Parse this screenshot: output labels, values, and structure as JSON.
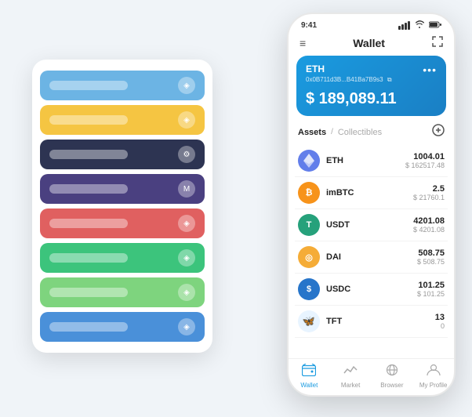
{
  "scene": {
    "card_stack": {
      "cards": [
        {
          "color": "#6cb4e4",
          "label": "",
          "icon": "◈"
        },
        {
          "color": "#f5c542",
          "label": "",
          "icon": "◈"
        },
        {
          "color": "#2d3452",
          "label": "",
          "icon": "⚙"
        },
        {
          "color": "#4a4080",
          "label": "",
          "icon": "M"
        },
        {
          "color": "#e06060",
          "label": "",
          "icon": "◈"
        },
        {
          "color": "#3cc47c",
          "label": "",
          "icon": "◈"
        },
        {
          "color": "#7ed47e",
          "label": "",
          "icon": "◈"
        },
        {
          "color": "#4a90d9",
          "label": "",
          "icon": "◈"
        }
      ]
    },
    "phone": {
      "status_bar": {
        "time": "9:41",
        "signal": "▐▐▐",
        "wifi": "WiFi",
        "battery": "🔋"
      },
      "header": {
        "menu_icon": "≡",
        "title": "Wallet",
        "expand_icon": "⛶"
      },
      "eth_card": {
        "title": "ETH",
        "address": "0x0B711d3B...B41Ba7B9s3",
        "copy_icon": "⧉",
        "amount": "$ 189,089.11",
        "more_icon": "•••"
      },
      "assets_section": {
        "tab_active": "Assets",
        "separator": "/",
        "tab_inactive": "Collectibles",
        "add_icon": "⊕"
      },
      "assets": [
        {
          "id": "eth",
          "name": "ETH",
          "amount": "1004.01",
          "usd": "$ 162517.48",
          "icon": "♦",
          "bg": "#627eea"
        },
        {
          "id": "imbtc",
          "name": "imBTC",
          "amount": "2.5",
          "usd": "$ 21760.1",
          "icon": "₿",
          "bg": "#f7931a"
        },
        {
          "id": "usdt",
          "name": "USDT",
          "amount": "4201.08",
          "usd": "$ 4201.08",
          "icon": "T",
          "bg": "#26a17b"
        },
        {
          "id": "dai",
          "name": "DAI",
          "amount": "508.75",
          "usd": "$ 508.75",
          "icon": "◎",
          "bg": "#f5ac37"
        },
        {
          "id": "usdc",
          "name": "USDC",
          "amount": "101.25",
          "usd": "$ 101.25",
          "icon": "$",
          "bg": "#2775ca"
        },
        {
          "id": "tft",
          "name": "TFT",
          "amount": "13",
          "usd": "0",
          "icon": "🦋",
          "bg": "#e8f4ff"
        }
      ],
      "nav": [
        {
          "id": "wallet",
          "label": "Wallet",
          "icon": "◎",
          "active": true
        },
        {
          "id": "market",
          "label": "Market",
          "icon": "📈",
          "active": false
        },
        {
          "id": "browser",
          "label": "Browser",
          "icon": "👤",
          "active": false
        },
        {
          "id": "profile",
          "label": "My Profile",
          "icon": "👤",
          "active": false
        }
      ]
    }
  }
}
